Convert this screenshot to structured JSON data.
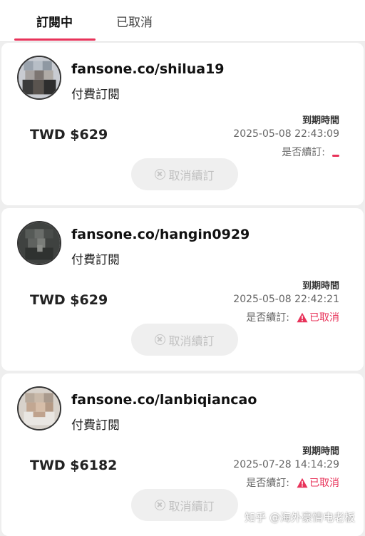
{
  "tabs": [
    {
      "label": "訂閱中",
      "active": true
    },
    {
      "label": "已取消",
      "active": false
    }
  ],
  "accent_color": "#e8335a",
  "subscriptions": [
    {
      "handle": "fansone.co/shilua19",
      "type": "付費訂閱",
      "price": "TWD $629",
      "expiry_label": "到期時間",
      "expiry": "2025-05-08 22:43:09",
      "renew_label": "是否續訂:",
      "renew_status": "",
      "cancel_label": "取消續訂"
    },
    {
      "handle": "fansone.co/hangin0929",
      "type": "付費訂閱",
      "price": "TWD $629",
      "expiry_label": "到期時間",
      "expiry": "2025-05-08 22:42:21",
      "renew_label": "是否續訂:",
      "renew_status": "已取消",
      "cancel_label": "取消續訂"
    },
    {
      "handle": "fansone.co/lanbiqiancao",
      "type": "付費訂閱",
      "price": "TWD $6182",
      "expiry_label": "到期時間",
      "expiry": "2025-07-28 14:14:29",
      "renew_label": "是否續訂:",
      "renew_status": "已取消",
      "cancel_label": "取消續訂"
    }
  ],
  "watermark": "知乎 @海外豪情电老板"
}
